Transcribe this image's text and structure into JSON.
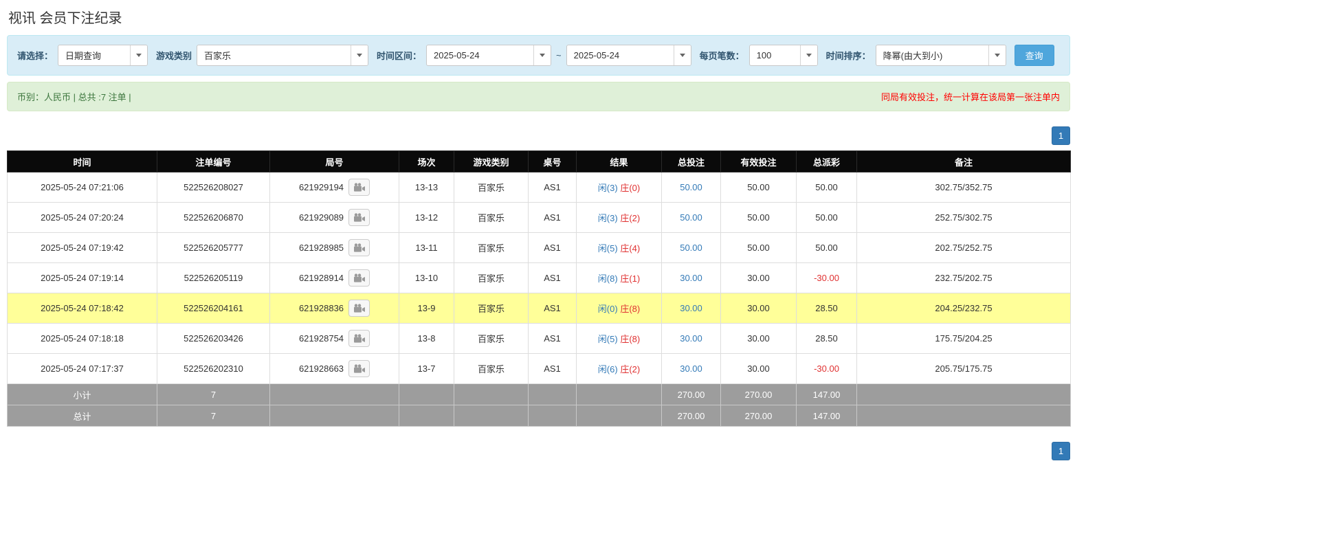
{
  "page": {
    "title": "视讯 会员下注纪录"
  },
  "filter": {
    "select_label": "请选择：",
    "select_value": "日期查询",
    "game_type_label": "游戏类别",
    "game_type_value": "百家乐",
    "time_range_label": "时间区间：",
    "date_from": "2025-05-24",
    "tilde": "~",
    "date_to": "2025-05-24",
    "per_page_label": "每页笔数：",
    "per_page_value": "100",
    "sort_label": "时间排序：",
    "sort_value": "降幂(由大到小)",
    "search_button": "查询"
  },
  "status": {
    "summary": "币别：人民币 | 总共 :7 注单 |",
    "notice": "同局有效投注，统一计算在该局第一张注单内"
  },
  "pagination": {
    "current_page": "1"
  },
  "table": {
    "headers": [
      "时间",
      "注单编号",
      "局号",
      "场次",
      "游戏类别",
      "桌号",
      "结果",
      "总投注",
      "有效投注",
      "总派彩",
      "备注"
    ],
    "rows": [
      {
        "time": "2025-05-24 07:21:06",
        "bet_id": "522526208027",
        "round_id": "621929194",
        "session": "13-13",
        "game": "百家乐",
        "table_no": "AS1",
        "result_player": "闲(3)",
        "result_banker": "庄(0)",
        "total_bet": "50.00",
        "valid_bet": "50.00",
        "payout": "50.00",
        "remark": "302.75/352.75"
      },
      {
        "time": "2025-05-24 07:20:24",
        "bet_id": "522526206870",
        "round_id": "621929089",
        "session": "13-12",
        "game": "百家乐",
        "table_no": "AS1",
        "result_player": "闲(3)",
        "result_banker": "庄(2)",
        "total_bet": "50.00",
        "valid_bet": "50.00",
        "payout": "50.00",
        "remark": "252.75/302.75"
      },
      {
        "time": "2025-05-24 07:19:42",
        "bet_id": "522526205777",
        "round_id": "621928985",
        "session": "13-11",
        "game": "百家乐",
        "table_no": "AS1",
        "result_player": "闲(5)",
        "result_banker": "庄(4)",
        "total_bet": "50.00",
        "valid_bet": "50.00",
        "payout": "50.00",
        "remark": "202.75/252.75"
      },
      {
        "time": "2025-05-24 07:19:14",
        "bet_id": "522526205119",
        "round_id": "621928914",
        "session": "13-10",
        "game": "百家乐",
        "table_no": "AS1",
        "result_player": "闲(8)",
        "result_banker": "庄(1)",
        "total_bet": "30.00",
        "valid_bet": "30.00",
        "payout": "-30.00",
        "remark": "232.75/202.75"
      },
      {
        "time": "2025-05-24 07:18:42",
        "bet_id": "522526204161",
        "round_id": "621928836",
        "session": "13-9",
        "game": "百家乐",
        "table_no": "AS1",
        "result_player": "闲(0)",
        "result_banker": "庄(8)",
        "total_bet": "30.00",
        "valid_bet": "30.00",
        "payout": "28.50",
        "remark": "204.25/232.75"
      },
      {
        "time": "2025-05-24 07:18:18",
        "bet_id": "522526203426",
        "round_id": "621928754",
        "session": "13-8",
        "game": "百家乐",
        "table_no": "AS1",
        "result_player": "闲(5)",
        "result_banker": "庄(8)",
        "total_bet": "30.00",
        "valid_bet": "30.00",
        "payout": "28.50",
        "remark": "175.75/204.25"
      },
      {
        "time": "2025-05-24 07:17:37",
        "bet_id": "522526202310",
        "round_id": "621928663",
        "session": "13-7",
        "game": "百家乐",
        "table_no": "AS1",
        "result_player": "闲(6)",
        "result_banker": "庄(2)",
        "total_bet": "30.00",
        "valid_bet": "30.00",
        "payout": "-30.00",
        "remark": "205.75/175.75"
      }
    ],
    "subtotal": {
      "label": "小计",
      "count": "7",
      "total_bet": "270.00",
      "valid_bet": "270.00",
      "payout": "147.00"
    },
    "grand_total": {
      "label": "总计",
      "count": "7",
      "total_bet": "270.00",
      "valid_bet": "270.00",
      "payout": "147.00"
    }
  }
}
